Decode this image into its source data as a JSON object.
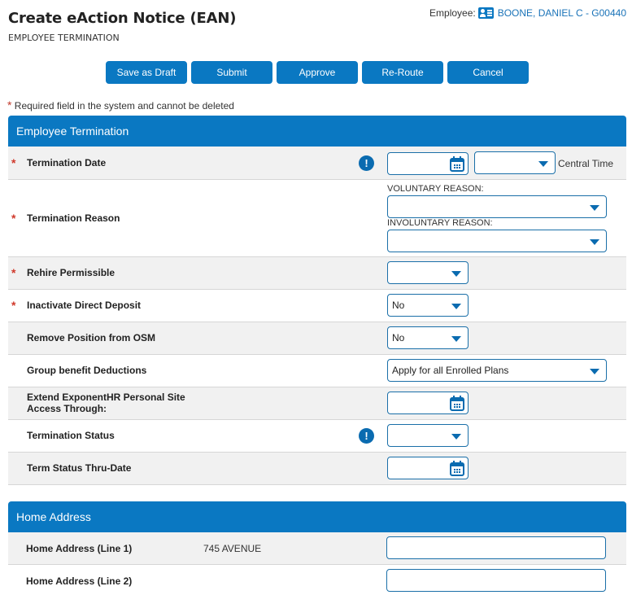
{
  "header": {
    "title": "Create eAction Notice (EAN)",
    "subtitle": "EMPLOYEE TERMINATION",
    "employee_label": "Employee:",
    "employee_icon": "id-card-icon",
    "employee_name": "BOONE, DANIEL C - G00440"
  },
  "toolbar": {
    "save_draft": "Save as Draft",
    "submit": "Submit",
    "approve": "Approve",
    "reroute": "Re-Route",
    "cancel": "Cancel"
  },
  "required_note": {
    "star": "*",
    "text": "Required field in the system and cannot be deleted"
  },
  "colors": {
    "accent": "#0a78c2",
    "required": "#d0392b",
    "link": "#1a73b8"
  },
  "termination": {
    "title": "Employee Termination",
    "fields": {
      "termination_date": {
        "label": "Termination Date",
        "required": "*",
        "date_value": "",
        "time_value": "",
        "timezone": "Central Time"
      },
      "termination_reason": {
        "label": "Termination Reason",
        "required": "*",
        "voluntary_label": "VOLUNTARY REASON:",
        "voluntary_value": "",
        "involuntary_label": "INVOLUNTARY REASON:",
        "involuntary_value": ""
      },
      "rehire_permissible": {
        "label": "Rehire Permissible",
        "required": "*",
        "value": ""
      },
      "inactivate_direct_deposit": {
        "label": "Inactivate Direct Deposit",
        "required": "*",
        "value": "No"
      },
      "remove_position_osm": {
        "label": "Remove Position from OSM",
        "value": "No"
      },
      "group_benefit_deductions": {
        "label": "Group benefit Deductions",
        "value": "Apply for all Enrolled Plans"
      },
      "extend_access": {
        "label_line1": "Extend ExponentHR Personal Site",
        "label_line2": "Access Through:",
        "value": ""
      },
      "termination_status": {
        "label": "Termination Status",
        "value": ""
      },
      "term_status_thru_date": {
        "label": "Term Status Thru-Date",
        "value": ""
      }
    }
  },
  "home_address": {
    "title": "Home Address",
    "line1": {
      "label": "Home Address (Line 1)",
      "current": "745 AVENUE",
      "value": ""
    },
    "line2": {
      "label": "Home Address (Line 2)",
      "current": "",
      "value": ""
    }
  }
}
